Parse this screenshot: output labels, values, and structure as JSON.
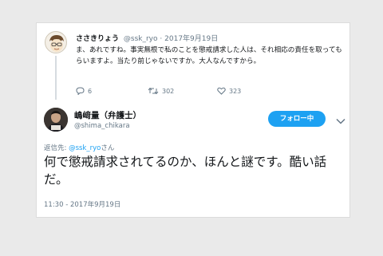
{
  "reply_tweet": {
    "display_name": "ささきりょう",
    "handle": "@ssk_ryo",
    "separator": "·",
    "date": "2017年9月19日",
    "text": "ま、あれですね。事実無根で私のことを懲戒請求した人は、それ相応の責任を取ってもらいますよ。当たり前じゃないですか。大人なんですから。",
    "reply_count": "6",
    "retweet_count": "302",
    "like_count": "323"
  },
  "main_tweet": {
    "display_name": "嶋﨑量（弁護士）",
    "handle": "@shima_chikara",
    "follow_label": "フォロー中",
    "replying_prefix": "返信先: ",
    "replying_mention": "@ssk_ryo",
    "replying_suffix": "さん",
    "text": "何で懲戒請求されてるのか、ほんと謎です。酷い話だ。",
    "timestamp": "11:30 - 2017年9月19日"
  },
  "colors": {
    "accent": "#1da1f2",
    "text": "#14171a",
    "muted": "#657786",
    "background": "#eaeaea"
  },
  "icons": {
    "reply": "speech-bubble-icon",
    "retweet": "retweet-arrows-icon",
    "like": "heart-icon",
    "more": "chevron-down-icon"
  }
}
